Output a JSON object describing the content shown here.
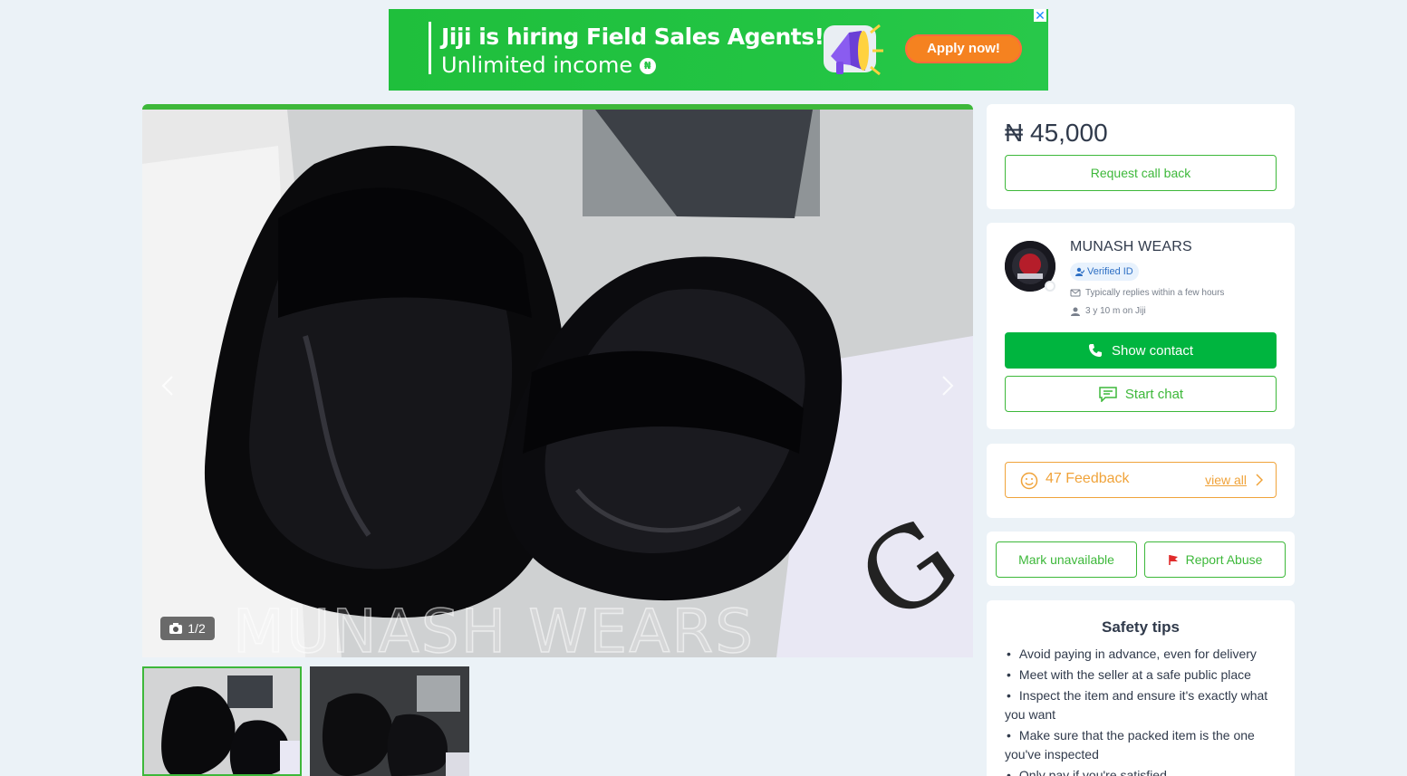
{
  "banner": {
    "headline": "Jiji is hiring Field Sales Agents!",
    "subline": "Unlimited income",
    "naira_symbol": "₦",
    "cta": "Apply now!",
    "close": "✕"
  },
  "gallery": {
    "counter": "1/2",
    "watermark": "MUNASH WEARS",
    "thumbnails": 2
  },
  "price": {
    "value": "₦ 45,000",
    "request_callback": "Request call back"
  },
  "seller": {
    "name": "MUNASH WEARS",
    "verified": "Verified ID",
    "replies": "Typically replies within a few hours",
    "member_for": "3 y 10 m on Jiji",
    "show_contact": "Show contact",
    "start_chat": "Start chat"
  },
  "feedback": {
    "label": "47 Feedback",
    "view_all": "view all"
  },
  "actions": {
    "mark_unavailable": "Mark unavailable",
    "report_abuse": "Report Abuse"
  },
  "safety": {
    "title": "Safety tips",
    "tips": [
      "Avoid paying in advance, even for delivery",
      "Meet with the seller at a safe public place",
      "Inspect the item and ensure it's exactly what you want",
      "Make sure that the packed item is the one you've inspected",
      "Only pay if you're satisfied"
    ]
  },
  "colors": {
    "brand_green": "#00b53f",
    "accent_orange": "#f0a33a",
    "background": "#ebf2f7"
  }
}
